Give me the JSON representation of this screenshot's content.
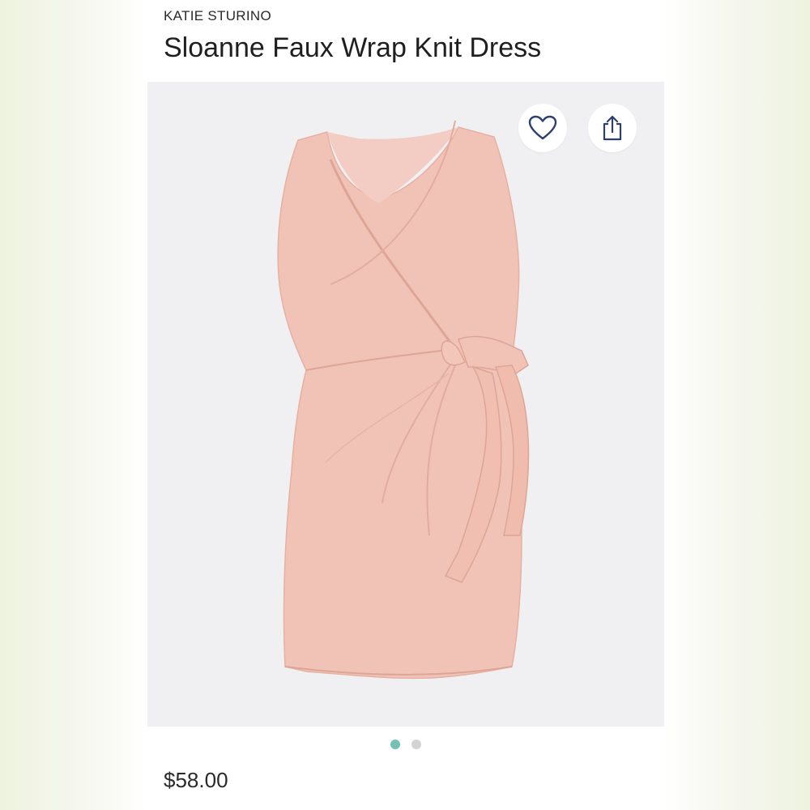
{
  "product": {
    "brand": "KATIE STURINO",
    "title": "Sloanne Faux Wrap Knit Dress",
    "price": "$58.00"
  },
  "actions": {
    "favorite_icon": "heart-outline-icon",
    "share_icon": "share-upload-icon"
  },
  "carousel": {
    "total_images": 2,
    "active_index": 0,
    "active_color": "#76bfb3",
    "inactive_color": "#d3d3d3"
  },
  "colors": {
    "dress": "#f1c3b6",
    "image_background": "#f0f0f2",
    "icon_color": "#2d3f6e"
  }
}
